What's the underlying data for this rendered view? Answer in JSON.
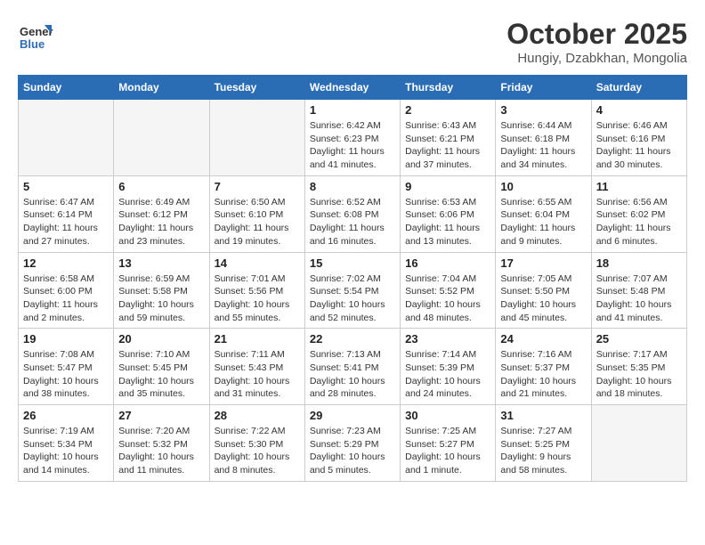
{
  "header": {
    "logo_line1": "General",
    "logo_line2": "Blue",
    "month": "October 2025",
    "location": "Hungiy, Dzabkhan, Mongolia"
  },
  "weekdays": [
    "Sunday",
    "Monday",
    "Tuesday",
    "Wednesday",
    "Thursday",
    "Friday",
    "Saturday"
  ],
  "weeks": [
    [
      {
        "day": "",
        "info": ""
      },
      {
        "day": "",
        "info": ""
      },
      {
        "day": "",
        "info": ""
      },
      {
        "day": "1",
        "info": "Sunrise: 6:42 AM\nSunset: 6:23 PM\nDaylight: 11 hours\nand 41 minutes."
      },
      {
        "day": "2",
        "info": "Sunrise: 6:43 AM\nSunset: 6:21 PM\nDaylight: 11 hours\nand 37 minutes."
      },
      {
        "day": "3",
        "info": "Sunrise: 6:44 AM\nSunset: 6:18 PM\nDaylight: 11 hours\nand 34 minutes."
      },
      {
        "day": "4",
        "info": "Sunrise: 6:46 AM\nSunset: 6:16 PM\nDaylight: 11 hours\nand 30 minutes."
      }
    ],
    [
      {
        "day": "5",
        "info": "Sunrise: 6:47 AM\nSunset: 6:14 PM\nDaylight: 11 hours\nand 27 minutes."
      },
      {
        "day": "6",
        "info": "Sunrise: 6:49 AM\nSunset: 6:12 PM\nDaylight: 11 hours\nand 23 minutes."
      },
      {
        "day": "7",
        "info": "Sunrise: 6:50 AM\nSunset: 6:10 PM\nDaylight: 11 hours\nand 19 minutes."
      },
      {
        "day": "8",
        "info": "Sunrise: 6:52 AM\nSunset: 6:08 PM\nDaylight: 11 hours\nand 16 minutes."
      },
      {
        "day": "9",
        "info": "Sunrise: 6:53 AM\nSunset: 6:06 PM\nDaylight: 11 hours\nand 13 minutes."
      },
      {
        "day": "10",
        "info": "Sunrise: 6:55 AM\nSunset: 6:04 PM\nDaylight: 11 hours\nand 9 minutes."
      },
      {
        "day": "11",
        "info": "Sunrise: 6:56 AM\nSunset: 6:02 PM\nDaylight: 11 hours\nand 6 minutes."
      }
    ],
    [
      {
        "day": "12",
        "info": "Sunrise: 6:58 AM\nSunset: 6:00 PM\nDaylight: 11 hours\nand 2 minutes."
      },
      {
        "day": "13",
        "info": "Sunrise: 6:59 AM\nSunset: 5:58 PM\nDaylight: 10 hours\nand 59 minutes."
      },
      {
        "day": "14",
        "info": "Sunrise: 7:01 AM\nSunset: 5:56 PM\nDaylight: 10 hours\nand 55 minutes."
      },
      {
        "day": "15",
        "info": "Sunrise: 7:02 AM\nSunset: 5:54 PM\nDaylight: 10 hours\nand 52 minutes."
      },
      {
        "day": "16",
        "info": "Sunrise: 7:04 AM\nSunset: 5:52 PM\nDaylight: 10 hours\nand 48 minutes."
      },
      {
        "day": "17",
        "info": "Sunrise: 7:05 AM\nSunset: 5:50 PM\nDaylight: 10 hours\nand 45 minutes."
      },
      {
        "day": "18",
        "info": "Sunrise: 7:07 AM\nSunset: 5:48 PM\nDaylight: 10 hours\nand 41 minutes."
      }
    ],
    [
      {
        "day": "19",
        "info": "Sunrise: 7:08 AM\nSunset: 5:47 PM\nDaylight: 10 hours\nand 38 minutes."
      },
      {
        "day": "20",
        "info": "Sunrise: 7:10 AM\nSunset: 5:45 PM\nDaylight: 10 hours\nand 35 minutes."
      },
      {
        "day": "21",
        "info": "Sunrise: 7:11 AM\nSunset: 5:43 PM\nDaylight: 10 hours\nand 31 minutes."
      },
      {
        "day": "22",
        "info": "Sunrise: 7:13 AM\nSunset: 5:41 PM\nDaylight: 10 hours\nand 28 minutes."
      },
      {
        "day": "23",
        "info": "Sunrise: 7:14 AM\nSunset: 5:39 PM\nDaylight: 10 hours\nand 24 minutes."
      },
      {
        "day": "24",
        "info": "Sunrise: 7:16 AM\nSunset: 5:37 PM\nDaylight: 10 hours\nand 21 minutes."
      },
      {
        "day": "25",
        "info": "Sunrise: 7:17 AM\nSunset: 5:35 PM\nDaylight: 10 hours\nand 18 minutes."
      }
    ],
    [
      {
        "day": "26",
        "info": "Sunrise: 7:19 AM\nSunset: 5:34 PM\nDaylight: 10 hours\nand 14 minutes."
      },
      {
        "day": "27",
        "info": "Sunrise: 7:20 AM\nSunset: 5:32 PM\nDaylight: 10 hours\nand 11 minutes."
      },
      {
        "day": "28",
        "info": "Sunrise: 7:22 AM\nSunset: 5:30 PM\nDaylight: 10 hours\nand 8 minutes."
      },
      {
        "day": "29",
        "info": "Sunrise: 7:23 AM\nSunset: 5:29 PM\nDaylight: 10 hours\nand 5 minutes."
      },
      {
        "day": "30",
        "info": "Sunrise: 7:25 AM\nSunset: 5:27 PM\nDaylight: 10 hours\nand 1 minute."
      },
      {
        "day": "31",
        "info": "Sunrise: 7:27 AM\nSunset: 5:25 PM\nDaylight: 9 hours\nand 58 minutes."
      },
      {
        "day": "",
        "info": ""
      }
    ]
  ]
}
